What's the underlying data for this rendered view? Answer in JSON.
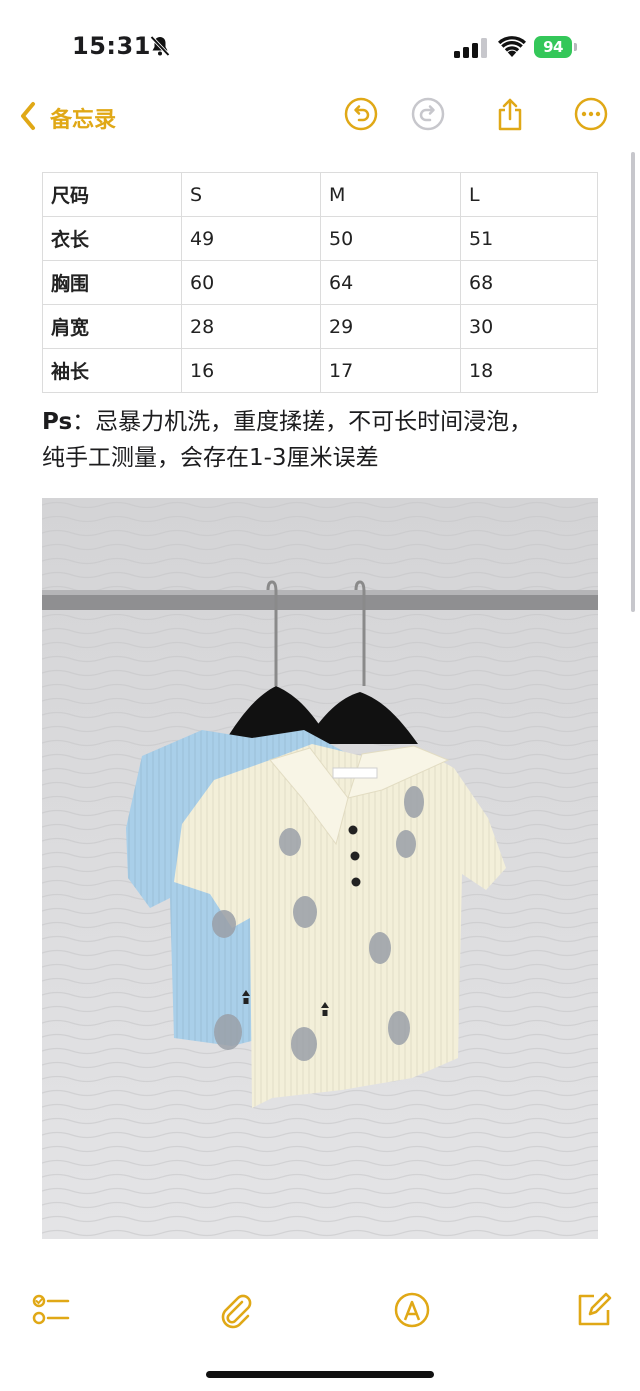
{
  "status_bar": {
    "time": "15:31",
    "battery_percent": "94",
    "icons": [
      "bell-slash-icon",
      "cellular-signal-icon",
      "wifi-icon",
      "battery-charging-icon"
    ]
  },
  "nav": {
    "back_label": "备忘录",
    "icons": [
      "chevron-left-icon",
      "undo-icon",
      "redo-icon",
      "share-icon",
      "more-icon"
    ]
  },
  "size_table": {
    "header": [
      "尺码",
      "S",
      "M",
      "L"
    ],
    "rows": [
      [
        "衣长",
        "49",
        "50",
        "51"
      ],
      [
        "胸围",
        "60",
        "64",
        "68"
      ],
      [
        "肩宽",
        "28",
        "29",
        "30"
      ],
      [
        "袖长",
        "16",
        "17",
        "18"
      ]
    ]
  },
  "note": {
    "prefix": "Ps",
    "line1": "：忌暴力机洗，重度揉搓，不可长时间浸泡，",
    "line2": "纯手工测量，会存在1-3厘米误差"
  },
  "photo": {
    "subject": "two-knit-polo-tops-on-hangers",
    "colors": {
      "blue_top": "#a9cfe9",
      "cream_top": "#f3efd9",
      "wall": "#d9d9d9",
      "rail": "#9a9a9a"
    }
  },
  "toolbar": {
    "icons": [
      "checklist-icon",
      "paperclip-icon",
      "markup-pen-icon",
      "compose-icon"
    ]
  },
  "accent_color": "#e0a816"
}
